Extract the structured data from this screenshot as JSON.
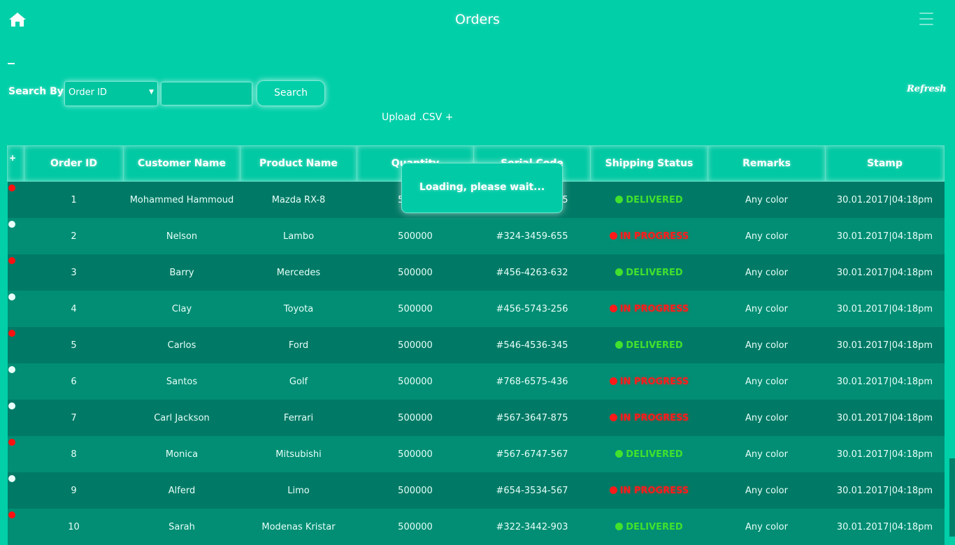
{
  "header": {
    "title": "Orders",
    "home_icon": "home-icon",
    "menu_icon": "hamburger-menu-icon"
  },
  "search": {
    "label": "Search By:",
    "field_value": "Order ID",
    "query_value": "",
    "button_label": "Search"
  },
  "refresh_label": "Refresh",
  "upload_label": "Upload .CSV +",
  "table": {
    "plus_header": "+",
    "headers": [
      "Order ID",
      "Customer Name",
      "Product Name",
      "Quantity",
      "Serial Code",
      "Shipping Status",
      "Remarks",
      "Stamp"
    ],
    "rows": [
      {
        "id": "1",
        "customer": "Mohammed Hammoud",
        "product": "Mazda RX-8",
        "quantity": "500000",
        "serial": "#345-3467-765",
        "status": "DELIVERED",
        "remarks": "Any color",
        "stamp": "30.01.2017|04:18pm"
      },
      {
        "id": "2",
        "customer": "Nelson",
        "product": "Lambo",
        "quantity": "500000",
        "serial": "#324-3459-655",
        "status": "IN PROGRESS",
        "remarks": "Any color",
        "stamp": "30.01.2017|04:18pm"
      },
      {
        "id": "3",
        "customer": "Barry",
        "product": "Mercedes",
        "quantity": "500000",
        "serial": "#456-4263-632",
        "status": "DELIVERED",
        "remarks": "Any color",
        "stamp": "30.01.2017|04:18pm"
      },
      {
        "id": "4",
        "customer": "Clay",
        "product": "Toyota",
        "quantity": "500000",
        "serial": "#456-5743-256",
        "status": "IN PROGRESS",
        "remarks": "Any color",
        "stamp": "30.01.2017|04:18pm"
      },
      {
        "id": "5",
        "customer": "Carlos",
        "product": "Ford",
        "quantity": "500000",
        "serial": "#546-4536-345",
        "status": "DELIVERED",
        "remarks": "Any color",
        "stamp": "30.01.2017|04:18pm"
      },
      {
        "id": "6",
        "customer": "Santos",
        "product": "Golf",
        "quantity": "500000",
        "serial": "#768-6575-436",
        "status": "IN PROGRESS",
        "remarks": "Any color",
        "stamp": "30.01.2017|04:18pm"
      },
      {
        "id": "7",
        "customer": "Carl Jackson",
        "product": "Ferrari",
        "quantity": "500000",
        "serial": "#567-3647-875",
        "status": "IN PROGRESS",
        "remarks": "Any color",
        "stamp": "30.01.2017|04:18pm"
      },
      {
        "id": "8",
        "customer": "Monica",
        "product": "Mitsubishi",
        "quantity": "500000",
        "serial": "#567-6747-567",
        "status": "DELIVERED",
        "remarks": "Any color",
        "stamp": "30.01.2017|04:18pm"
      },
      {
        "id": "9",
        "customer": "Alferd",
        "product": "Limo",
        "quantity": "500000",
        "serial": "#654-3534-567",
        "status": "IN PROGRESS",
        "remarks": "Any color",
        "stamp": "30.01.2017|04:18pm"
      },
      {
        "id": "10",
        "customer": "Sarah",
        "product": "Modenas Kristar",
        "quantity": "500000",
        "serial": "#322-3442-903",
        "status": "DELIVERED",
        "remarks": "Any color",
        "stamp": "30.01.2017|04:18pm"
      }
    ]
  },
  "loading_text": "Loading, please wait...",
  "colors": {
    "background": "#00cfa8",
    "row_dark": "#007a66",
    "row_light": "#018e74",
    "delivered": "#41e12e",
    "in_progress": "#ff1a1a",
    "unread_dot": "#ff1010",
    "read_dot": "#e8fff9"
  }
}
